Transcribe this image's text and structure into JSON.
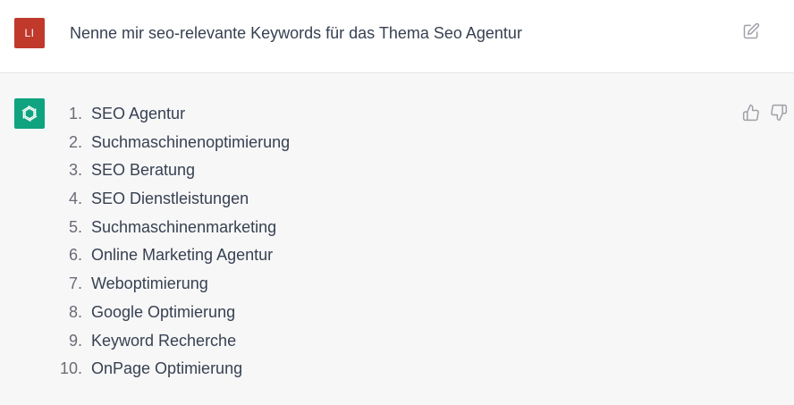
{
  "user": {
    "avatar_initials": "LI",
    "avatar_color": "#c0392b",
    "message": "Nenne mir seo-relevante Keywords für das Thema Seo Agentur"
  },
  "assistant": {
    "avatar_color": "#10a37f",
    "list": [
      {
        "num": "1.",
        "text": "SEO Agentur"
      },
      {
        "num": "2.",
        "text": "Suchmaschinenoptimierung"
      },
      {
        "num": "3.",
        "text": "SEO Beratung"
      },
      {
        "num": "4.",
        "text": "SEO Dienstleistungen"
      },
      {
        "num": "5.",
        "text": "Suchmaschinenmarketing"
      },
      {
        "num": "6.",
        "text": "Online Marketing Agentur"
      },
      {
        "num": "7.",
        "text": "Weboptimierung"
      },
      {
        "num": "8.",
        "text": "Google Optimierung"
      },
      {
        "num": "9.",
        "text": "Keyword Recherche"
      },
      {
        "num": "10.",
        "text": "OnPage Optimierung"
      }
    ]
  },
  "icons": {
    "edit": "edit-icon",
    "thumbs_up": "thumbs-up-icon",
    "thumbs_down": "thumbs-down-icon",
    "assistant_logo": "openai-logo-icon"
  }
}
